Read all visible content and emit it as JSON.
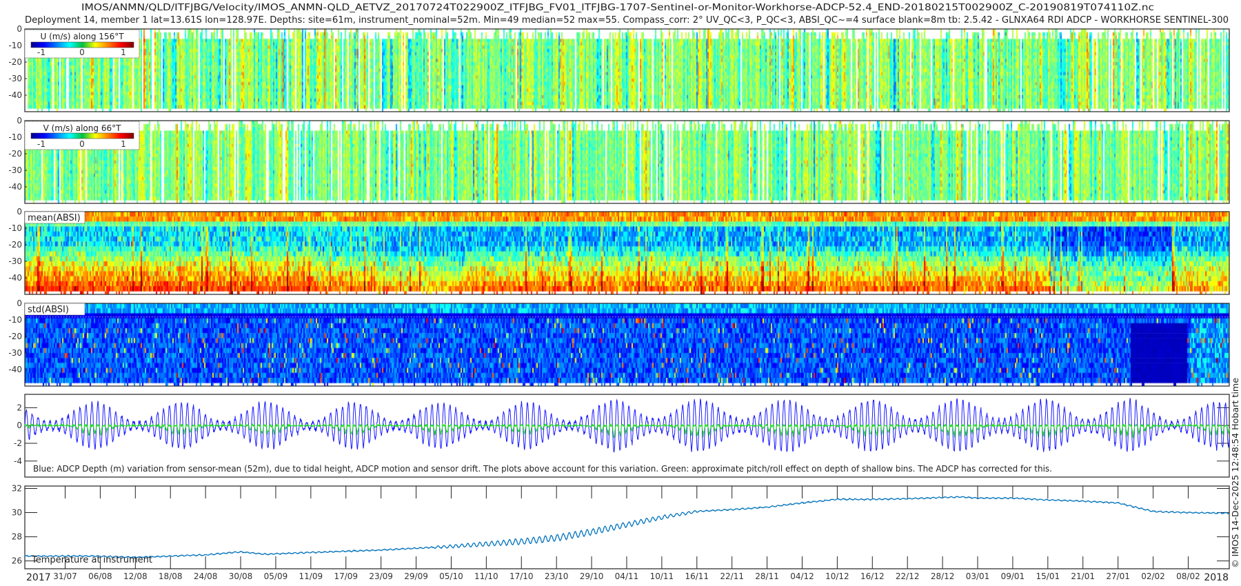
{
  "title": {
    "line1": "IMOS/ANMN/QLD/ITFJBG/Velocity/IMOS_ANMN-QLD_AETVZ_20170724T022900Z_ITFJBG_FV01_ITFJBG-1707-Sentinel-or-Monitor-Workhorse-ADCP-52.4_END-20180215T002900Z_C-20190819T074110Z.nc",
    "line2": "Deployment 14, member 1 lat=13.61S lon=128.97E. Depths: site=61m, instrument_nominal=52m. Min=49 median=52 max=55. Compass_corr: 2° UV_QC<3, P_QC<3, ABSI_QC~=4 surface blank=8m tb: 2.5.42 - GLNXA64 RDI ADCP - WORKHORSE SENTINEL-300"
  },
  "footer": {
    "credit": "© IMOS 14-Dec-2025 12:48:54 Hobart time",
    "year_start": "2017",
    "year_end": "2018"
  },
  "colors": {
    "depth_line": "#1a1aff",
    "pitch_roll_line": "#22dd22",
    "temperature_line": "#0072bd",
    "axis": "#222222"
  },
  "chart_data": [
    {
      "type": "heatmap",
      "panel": "u-velocity",
      "legend_title": "U (m/s) along 156°T",
      "colorbar_ticks": [
        "-1",
        "0",
        "1"
      ],
      "color_range": [
        -1.25,
        1.25
      ],
      "colormap": "jet",
      "ylabel_ticks": [
        "0",
        "-10",
        "-20",
        "-30",
        "-40"
      ],
      "ylim": [
        -50,
        0
      ],
      "data_depth_range": [
        -48,
        -1
      ],
      "typical_value": 0.0,
      "typical_spread": 0.25
    },
    {
      "type": "heatmap",
      "panel": "v-velocity",
      "legend_title": "V (m/s) along 66°T",
      "colorbar_ticks": [
        "-1",
        "0",
        "1"
      ],
      "color_range": [
        -1.25,
        1.25
      ],
      "colormap": "jet",
      "ylabel_ticks": [
        "0",
        "-10",
        "-20",
        "-30",
        "-40"
      ],
      "ylim": [
        -50,
        0
      ],
      "data_depth_range": [
        -48,
        -1
      ],
      "typical_value": 0.0,
      "typical_spread": 0.22
    },
    {
      "type": "heatmap",
      "panel": "mean-absi",
      "legend_title": "mean(ABSI)",
      "colormap": "jet",
      "ylabel_ticks": [
        "0",
        "-10",
        "-20",
        "-30",
        "-40"
      ],
      "ylim": [
        -50,
        0
      ],
      "surface_blank_depth": -8,
      "description_levels": {
        "surface_rows": 0.72,
        "mid_water": 0.32,
        "near_bottom": 0.75
      }
    },
    {
      "type": "heatmap",
      "panel": "std-absi",
      "legend_title": "std(ABSI)",
      "colormap": "jet",
      "ylabel_ticks": [
        "0",
        "-10",
        "-20",
        "-30",
        "-40"
      ],
      "ylim": [
        -50,
        0
      ],
      "surface_blank_depth": -8,
      "low_variance_period": [
        "2018-01-29",
        "2018-02-07"
      ]
    },
    {
      "type": "line",
      "panel": "depth-variation",
      "annotation": "Blue: ADCP Depth (m) variation from sensor-mean (52m), due to tidal height, ADCP motion and sensor drift. The plots above account for this variation. Green: approximate pitch/roll effect on depth of shallow bins. The ADCP has corrected for this.",
      "ylabel_ticks": [
        "2",
        "0",
        "-2",
        "-4"
      ],
      "ylim": [
        -5.8,
        3.5
      ],
      "series": [
        {
          "name": "ADCP depth variation",
          "model": "tidal",
          "mean": 0,
          "mean_amplitude": 1.5,
          "spring_neap_amplitude": 1.1,
          "spring_neap_period_days": 14.77,
          "first_spring_date": "2017-08-05"
        },
        {
          "name": "pitch/roll effect",
          "model": "negative spikes",
          "max_magnitude": 2.5
        }
      ]
    },
    {
      "type": "line",
      "panel": "temperature",
      "label": "Temperature at instrument",
      "ylabel_ticks": [
        "32",
        "30",
        "28",
        "26"
      ],
      "ylim": [
        25.35,
        32.2
      ],
      "x": [
        "2017-07-24",
        "2017-08-05",
        "2017-08-12",
        "2017-08-24",
        "2017-08-30",
        "2017-09-03",
        "2017-09-11",
        "2017-09-23",
        "2017-10-05",
        "2017-10-17",
        "2017-10-23",
        "2017-10-29",
        "2017-11-04",
        "2017-11-10",
        "2017-11-16",
        "2017-11-22",
        "2017-11-28",
        "2017-12-04",
        "2017-12-10",
        "2017-12-16",
        "2017-12-22",
        "2017-12-31",
        "2018-01-03",
        "2018-01-09",
        "2018-01-15",
        "2018-01-21",
        "2018-01-27",
        "2018-02-02",
        "2018-02-08",
        "2018-02-15"
      ],
      "values": [
        26.4,
        26.4,
        26.3,
        26.5,
        26.75,
        26.55,
        26.7,
        26.9,
        27.2,
        27.6,
        27.9,
        28.4,
        29.0,
        29.6,
        30.1,
        30.25,
        30.45,
        30.8,
        31.1,
        31.1,
        31.15,
        31.3,
        31.2,
        31.2,
        31.05,
        30.95,
        30.8,
        30.1,
        30.0,
        29.95
      ]
    }
  ],
  "x_axis": {
    "range": [
      "2017-07-24T02:29:00Z",
      "2018-02-15T00:29:00Z"
    ],
    "tick_labels": [
      "31/07",
      "06/08",
      "12/08",
      "18/08",
      "24/08",
      "30/08",
      "05/09",
      "11/09",
      "17/09",
      "23/09",
      "29/09",
      "05/10",
      "11/10",
      "17/10",
      "23/10",
      "29/10",
      "04/11",
      "10/11",
      "16/11",
      "22/11",
      "28/11",
      "04/12",
      "10/12",
      "16/12",
      "22/12",
      "28/12",
      "03/01",
      "09/01",
      "15/01",
      "21/01",
      "27/01",
      "02/02",
      "08/02"
    ]
  }
}
